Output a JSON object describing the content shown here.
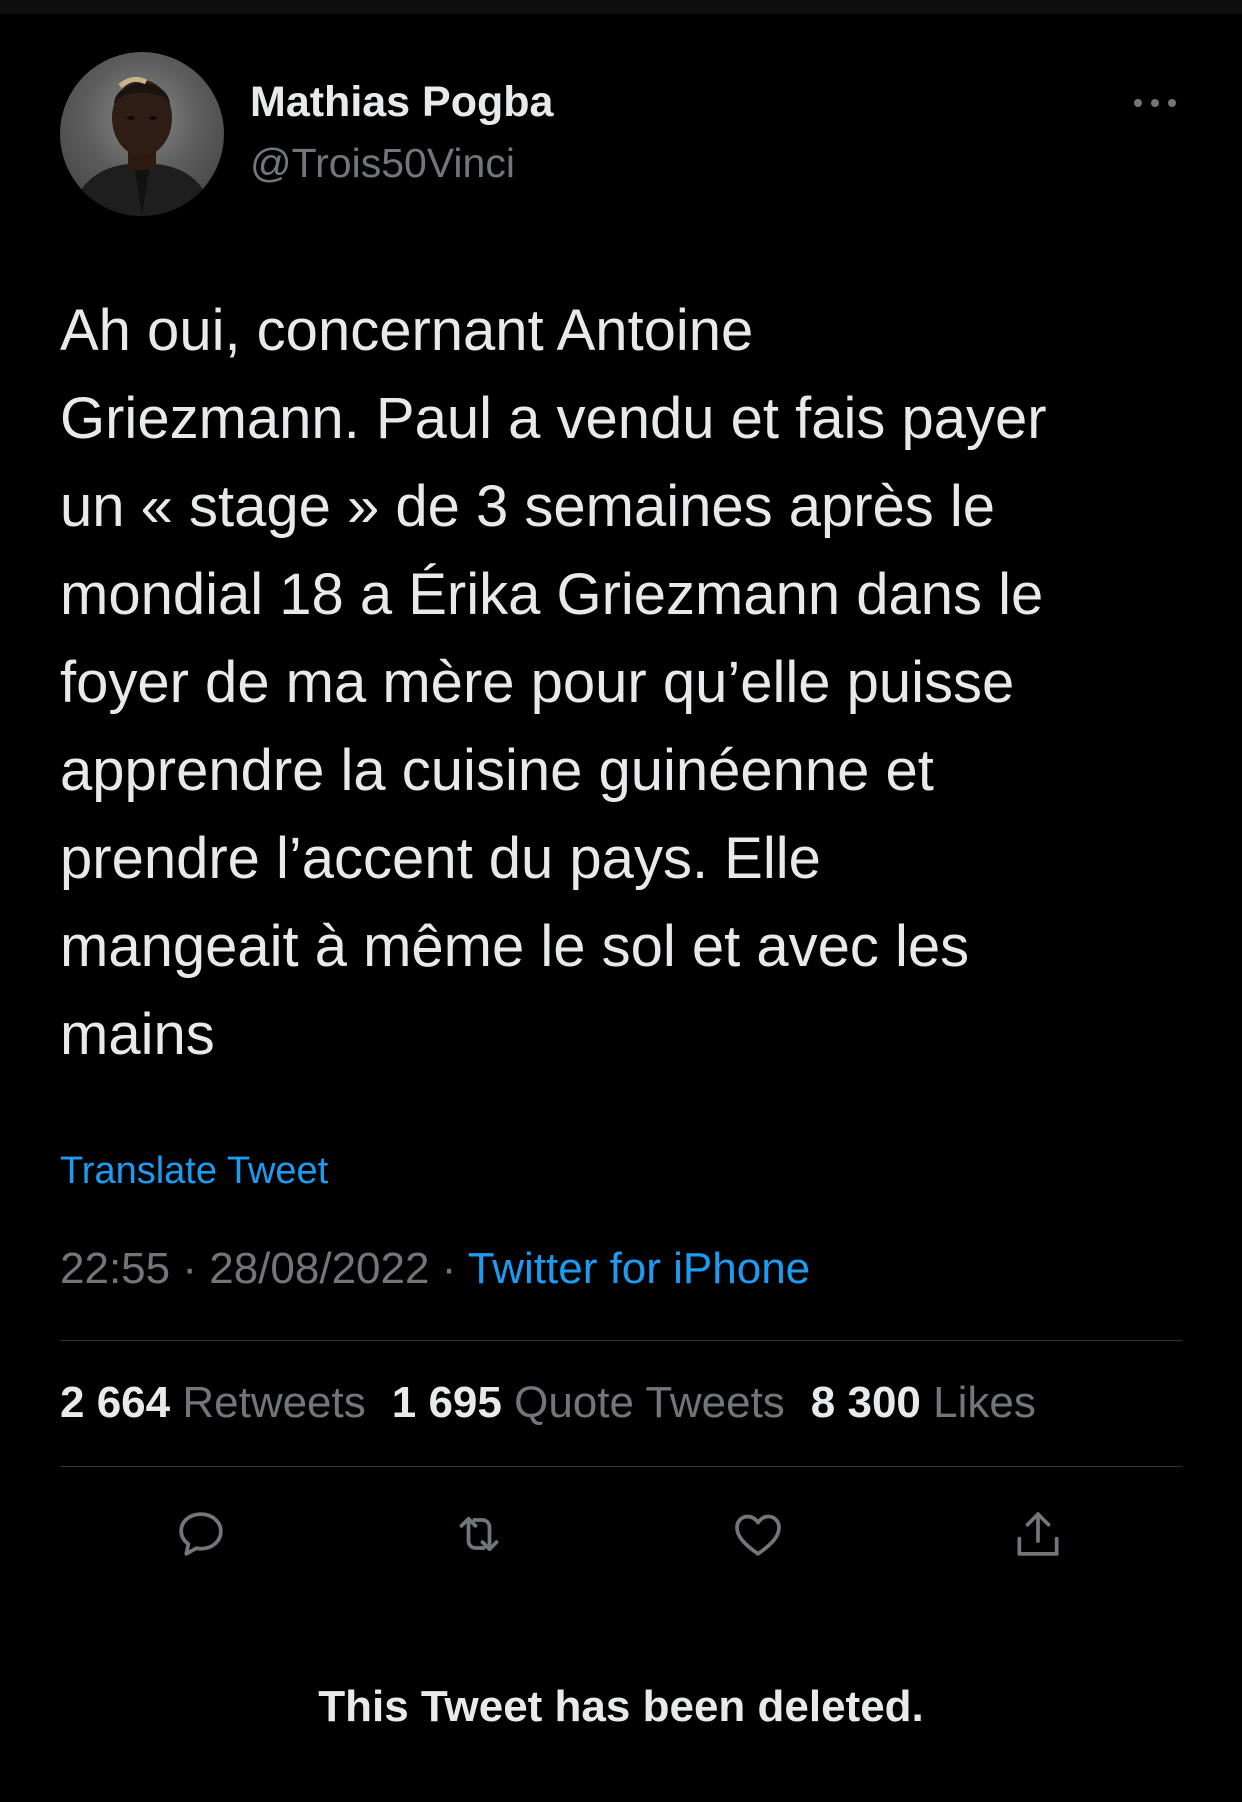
{
  "user": {
    "display_name": "Mathias Pogba",
    "handle": "@Trois50Vinci"
  },
  "tweet": {
    "text": "Ah oui, concernant Antoine\nGriezmann. Paul a vendu et fais payer\nun « stage » de 3 semaines après le\nmondial 18 a Érika Griezmann dans le\nfoyer de ma mère pour qu’elle puisse\napprendre la cuisine guinéenne et\nprendre l’accent du pays. Elle\nmangeait à même le sol et avec les\nmains",
    "translate_label": "Translate Tweet",
    "time": "22:55",
    "date": "28/08/2022",
    "separator": "·",
    "source": "Twitter for iPhone"
  },
  "stats": {
    "retweets_count": "2 664",
    "retweets_label": "Retweets",
    "quotes_count": "1 695",
    "quotes_label": "Quote Tweets",
    "likes_count": "8 300",
    "likes_label": "Likes"
  },
  "actions": [
    "reply-icon",
    "retweet-icon",
    "like-icon",
    "share-icon"
  ],
  "footer": {
    "deleted_notice": "This Tweet has been deleted."
  },
  "colors": {
    "background": "#000000",
    "text": "#e7e9ea",
    "muted": "#71767b",
    "link": "#1d9bf0",
    "divider": "#2f3336"
  }
}
